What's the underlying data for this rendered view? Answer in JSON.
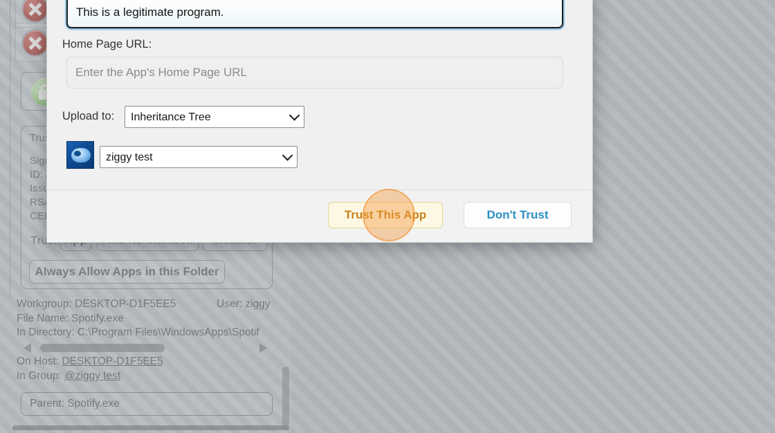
{
  "background_panel": {
    "icons": [
      {
        "name": "blocked-icon-1",
        "glyph": "red-x-circle"
      },
      {
        "name": "blocked-icon-2",
        "glyph": "red-x-circle"
      },
      {
        "name": "secure-lock-icon",
        "glyph": "green-lock"
      }
    ],
    "certificate_lines": [
      "Trus",
      "Sign",
      "ID: A",
      "Issu",
      "RSA",
      "CER"
    ],
    "trust_row_label": "Trust:",
    "trust_buttons": [
      "App",
      "And Its Children",
      "Installer"
    ],
    "always_allow_label": "Always Allow Apps in this Folder",
    "workgroup_label": "Workgroup: DESKTOP-D1F5EE5",
    "user_label": "User: ziggy",
    "file_name_label": "File Name: Spotify.exe",
    "directory_label": "In Directory: C:\\Program Files\\WindowsApps\\Spotif",
    "on_host_prefix": "On Host: ",
    "on_host_value": "DESKTOP-D1F5EE5",
    "in_group_prefix": "In Group: ",
    "in_group_value": "@ziggy test",
    "parent_label": "Parent: Spotify.exe"
  },
  "dialog": {
    "description_value": "This is a legitimate program.",
    "home_page_url_label": "Home Page URL:",
    "home_page_url_value": "",
    "home_page_url_placeholder": "Enter the App's Home Page URL",
    "upload_to_label": "Upload to:",
    "upload_to_value": "Inheritance Tree",
    "upload_to_options": [
      "Inheritance Tree"
    ],
    "group_select_value": "ziggy test",
    "group_select_options": [
      "ziggy test"
    ],
    "app_icon_name": "cloud-app-icon",
    "buttons": {
      "trust_label": "Trust This App",
      "dont_trust_label": "Don't Trust"
    }
  },
  "colors": {
    "trust_button_text": "#c8821a",
    "trust_button_bg": "#fdf8e3",
    "dont_trust_text": "#2a8fc4",
    "click_highlight": "#f4983b"
  }
}
